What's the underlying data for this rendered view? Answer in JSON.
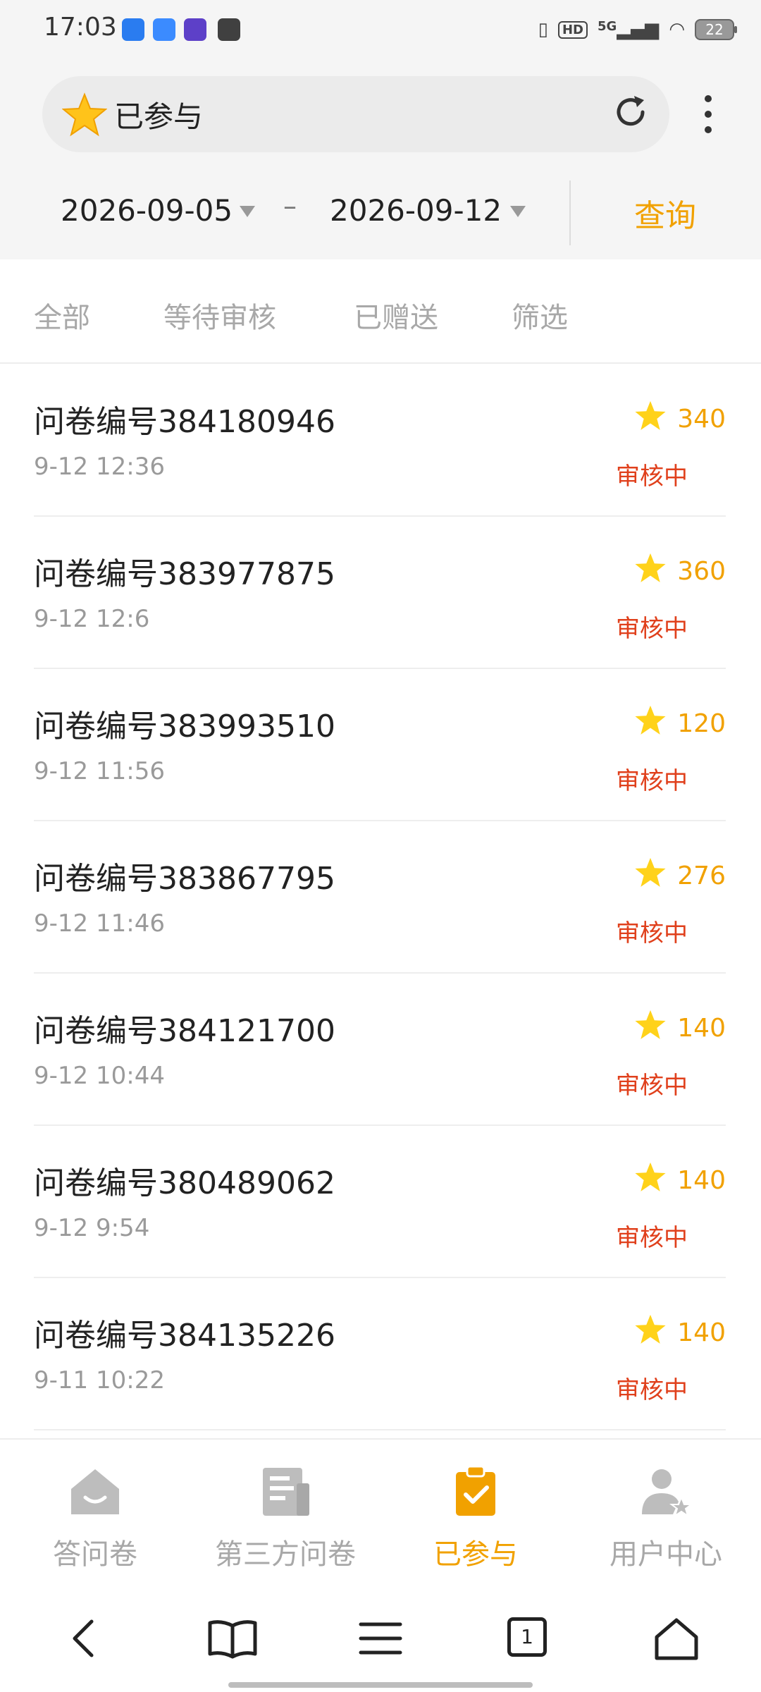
{
  "status_bar": {
    "time": "17:03",
    "signal": "5G",
    "hd": "HD",
    "battery": "22"
  },
  "header": {
    "title": "已参与",
    "refresh_icon": "refresh-icon",
    "more_icon": "more-vertical-icon"
  },
  "date_filter": {
    "start": "2026-09-05",
    "end": "2026-09-12",
    "separator": "–",
    "query_label": "查询"
  },
  "tabs": [
    {
      "label": "全部"
    },
    {
      "label": "等待审核"
    },
    {
      "label": "已赠送"
    },
    {
      "label": "筛选"
    }
  ],
  "list": [
    {
      "title": "问卷编号384180946",
      "time": "9-12 12:36",
      "points": "340",
      "status": "审核中"
    },
    {
      "title": "问卷编号383977875",
      "time": "9-12 12:6",
      "points": "360",
      "status": "审核中"
    },
    {
      "title": "问卷编号383993510",
      "time": "9-12 11:56",
      "points": "120",
      "status": "审核中"
    },
    {
      "title": "问卷编号383867795",
      "time": "9-12 11:46",
      "points": "276",
      "status": "审核中"
    },
    {
      "title": "问卷编号384121700",
      "time": "9-12 10:44",
      "points": "140",
      "status": "审核中"
    },
    {
      "title": "问卷编号380489062",
      "time": "9-12 9:54",
      "points": "140",
      "status": "审核中"
    },
    {
      "title": "问卷编号384135226",
      "time": "9-11 10:22",
      "points": "140",
      "status": "审核中"
    }
  ],
  "bottom_nav": [
    {
      "label": "答问卷",
      "icon": "home-icon"
    },
    {
      "label": "第三方问卷",
      "icon": "document-icon"
    },
    {
      "label": "已参与",
      "icon": "clipboard-check-icon",
      "active": true
    },
    {
      "label": "用户中心",
      "icon": "user-star-icon"
    }
  ],
  "browser_bar": {
    "tab_count": "1"
  },
  "colors": {
    "accent": "#f1a100",
    "status_red": "#e0401c",
    "muted": "#a8a8a8"
  }
}
